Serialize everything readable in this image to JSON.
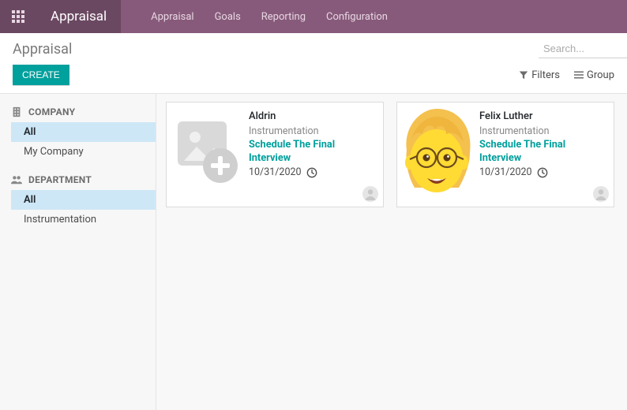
{
  "navbar": {
    "app_title": "Appraisal",
    "items": [
      "Appraisal",
      "Goals",
      "Reporting",
      "Configuration"
    ]
  },
  "control_panel": {
    "breadcrumb": "Appraisal",
    "search_placeholder": "Search...",
    "create_label": "CREATE",
    "filters_label": "Filters",
    "group_label": "Group"
  },
  "sidebar": {
    "groups": [
      {
        "header": "COMPANY",
        "items": [
          {
            "label": "All",
            "selected": true
          },
          {
            "label": "My Company",
            "selected": false
          }
        ]
      },
      {
        "header": "DEPARTMENT",
        "items": [
          {
            "label": "All",
            "selected": true
          },
          {
            "label": "Instrumentation",
            "selected": false
          }
        ]
      }
    ]
  },
  "cards": [
    {
      "name": "Aldrin",
      "department": "Instrumentation",
      "action": "Schedule The Final Interview",
      "date": "10/31/2020",
      "image_kind": "placeholder"
    },
    {
      "name": "Felix Luther",
      "department": "Instrumentation",
      "action": "Schedule The Final Interview",
      "date": "10/31/2020",
      "image_kind": "felix"
    }
  ]
}
